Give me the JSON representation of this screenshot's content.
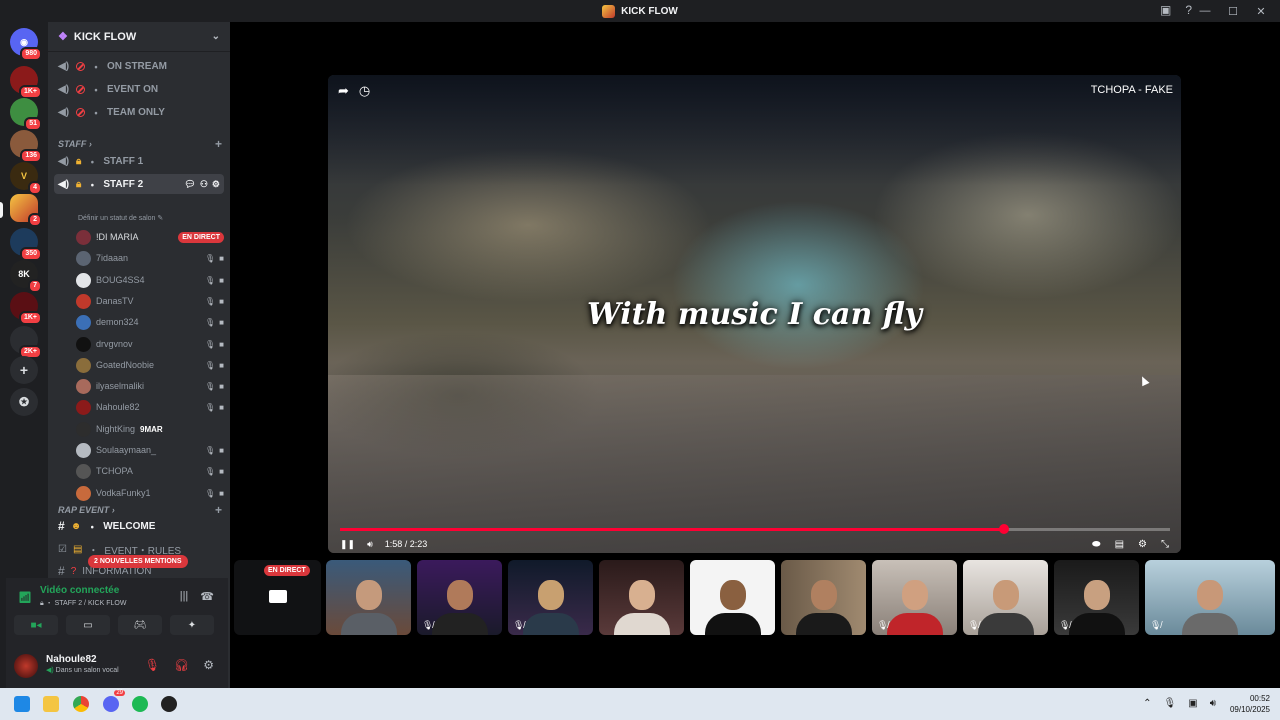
{
  "window": {
    "title": "KICK FLOW",
    "minimize": "—",
    "maximize": "☐",
    "close": "✕"
  },
  "rail": {
    "badges": [
      "980",
      "1K+",
      "51",
      "136",
      "4",
      "2",
      "350",
      "7",
      "1K+",
      "2K+"
    ]
  },
  "server": {
    "name": "KICK FLOW",
    "status_hint": "Définir un statut de salon"
  },
  "channels": [
    {
      "name": "ON STREAM"
    },
    {
      "name": "EVENT ON"
    },
    {
      "name": "TEAM ONLY"
    }
  ],
  "categories": {
    "staff": "STAFF",
    "rap_event": "RAP EVENT"
  },
  "staff_channels": [
    "STAFF 1",
    "STAFF 2"
  ],
  "voice_users": [
    {
      "name": "!DI MARIA",
      "live": "EN DIRECT",
      "color": "#7a2f3a"
    },
    {
      "name": "7idaaan",
      "color": "#5b6472"
    },
    {
      "name": "BOUG4SS4",
      "color": "#e3e5e8"
    },
    {
      "name": "DanasTV",
      "color": "#c0392b"
    },
    {
      "name": "demon324",
      "color": "#3b6fb6"
    },
    {
      "name": "drvgvnov",
      "color": "#111111"
    },
    {
      "name": "GoatedNoobie",
      "color": "#8a6d3b"
    },
    {
      "name": "ilyaselmaliki",
      "color": "#a86a5c"
    },
    {
      "name": "Nahoule82",
      "color": "#8b1a1a"
    },
    {
      "name": "NightKing",
      "tag": "9MAR",
      "color": "#2d2d2d"
    },
    {
      "name": "Soulaaymaan_",
      "color": "#b5bac1"
    },
    {
      "name": "TCHOPA",
      "color": "#555555"
    },
    {
      "name": "VodkaFunky1",
      "color": "#c86a3c"
    }
  ],
  "rap_channels": [
    {
      "name": "WELCOME"
    },
    {
      "name": "EVENT・RULES"
    },
    {
      "name": "INFORMATION"
    }
  ],
  "mentions_pill": "2 NOUVELLES MENTIONS",
  "voice_panel": {
    "title": "Vidéo connectée",
    "subtitle": "STAFF 2 / KICK FLOW"
  },
  "user": {
    "name": "Nahoule82",
    "status": "Dans un salon vocal"
  },
  "video": {
    "title": "TCHOPA - FAKE",
    "lyric": "With music I can fly",
    "time": "1:58 / 2:23",
    "progress": 0.8
  },
  "strip": {
    "live_label": "EN DIRECT"
  },
  "taskbar": {
    "discord_badge": "29",
    "time": "00:52",
    "date": "09/10/2025"
  }
}
